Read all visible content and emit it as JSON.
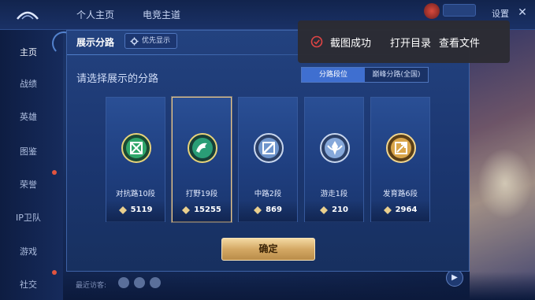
{
  "header": {
    "tabs": [
      "个人主页",
      "电竞主道"
    ],
    "settings_label": "设置"
  },
  "sidebar": {
    "items": [
      {
        "label": "主页",
        "active": true
      },
      {
        "label": "战绩"
      },
      {
        "label": "英雄"
      },
      {
        "label": "图鉴"
      },
      {
        "label": "荣誉"
      },
      {
        "label": "IP卫队"
      },
      {
        "label": "游戏"
      },
      {
        "label": "社交"
      }
    ]
  },
  "bottom": {
    "status": "最近访客:"
  },
  "modal": {
    "title": "展示分路",
    "priority_button": "优先显示",
    "subtitle": "请选择展示的分路",
    "tabs": [
      {
        "label": "分路段位",
        "active": true
      },
      {
        "label": "巅峰分路(全国)"
      }
    ],
    "cards": [
      {
        "label": "对抗路10段",
        "value": "5119",
        "emblem": "clash-lane-emblem",
        "color": "#3fae6a",
        "selected": false
      },
      {
        "label": "打野19段",
        "value": "15255",
        "emblem": "jungle-emblem",
        "color": "#2f9f73",
        "selected": true
      },
      {
        "label": "中路2段",
        "value": "869",
        "emblem": "mid-lane-emblem",
        "color": "#7fa6d9",
        "selected": false
      },
      {
        "label": "游走1段",
        "value": "210",
        "emblem": "roam-emblem",
        "color": "#8fb1df",
        "selected": false
      },
      {
        "label": "发育路6段",
        "value": "2964",
        "emblem": "farm-lane-emblem",
        "color": "#d9a54a",
        "selected": false
      }
    ],
    "confirm_label": "确定"
  },
  "toast": {
    "message": "截图成功",
    "open_folder": "打开目录",
    "view_file": "查看文件"
  }
}
